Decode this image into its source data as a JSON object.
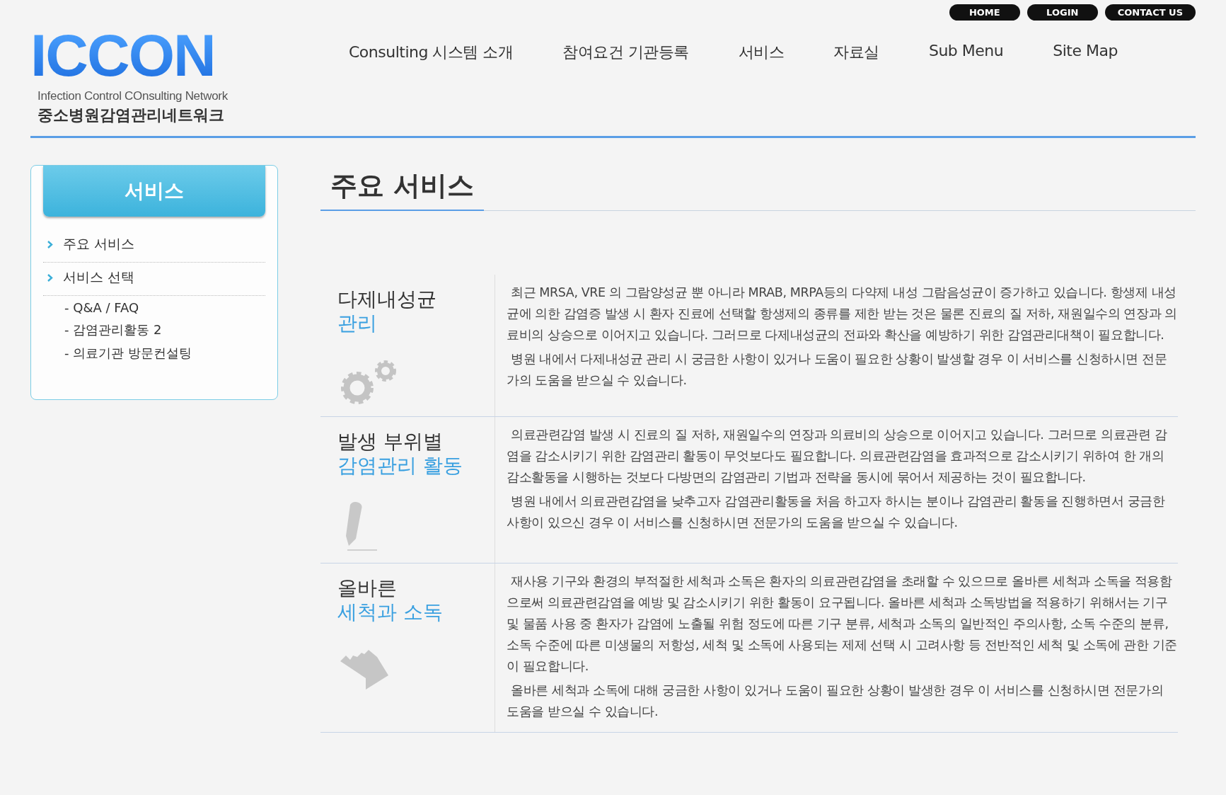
{
  "logo": {
    "title": "ICCON",
    "subtitle": "Infection Control COnsulting Network",
    "korean_name": "중소병원감염관리네트워크"
  },
  "top_links": [
    "HOME",
    "LOGIN",
    "CONTACT US"
  ],
  "nav": [
    "Consulting 시스템 소개",
    "참여요건 기관등록",
    "서비스",
    "자료실",
    "Sub Menu",
    "Site Map"
  ],
  "sidebar": {
    "title": "서비스",
    "items": [
      {
        "kind": "main",
        "label": "주요 서비스"
      },
      {
        "kind": "main",
        "label": "서비스 선택"
      },
      {
        "kind": "sub",
        "label": "- Q&A / FAQ"
      },
      {
        "kind": "sub",
        "label": "- 감염관리활동 2"
      },
      {
        "kind": "sub",
        "label": "- 의료기관 방문컨설팅"
      }
    ]
  },
  "page_title": "주요 서비스",
  "sections": [
    {
      "title": "다제내성균",
      "title_accent": "관리",
      "kind": "gears",
      "paragraphs": [
        "최근 MRSA, VRE 의 그람양성균 뿐 아니라 MRAB, MRPA등의 다약제 내성 그람음성균이 증가하고 있습니다. 항생제 내성균에 의한 감염증 발생 시 환자 진료에 선택할 항생제의 종류를 제한 받는 것은 물론 진료의 질 저하, 재원일수의 연장과 의료비의 상승으로 이어지고 있습니다. 그러므로 다제내성균의 전파와 확산을 예방하기 위한 감염관리대책이 필요합니다.",
        "병원 내에서 다제내성균 관리 시 궁금한 사항이 있거나 도움이 필요한 상황이 발생할 경우 이 서비스를 신청하시면 전문가의 도움을 받으실 수 있습니다."
      ]
    },
    {
      "title": "발생 부위별",
      "title_accent": "감염관리 활동",
      "kind": "pencil",
      "paragraphs": [
        "의료관련감염 발생 시 진료의 질 저하, 재원일수의 연장과 의료비의 상승으로 이어지고 있습니다. 그러므로 의료관련 감염을 감소시키기 위한 감염관리 활동이 무엇보다도 필요합니다. 의료관련감염을 효과적으로 감소시키기 위하여 한 개의 감소활동을 시행하는 것보다 다방면의 감염관리 기법과 전략을 동시에 묶어서 제공하는 것이 필요합니다.",
        "병원 내에서 의료관련감염을 낮추고자 감염관리활동을 처음 하고자 하시는 분이나 감염관리 활동을 진행하면서 궁금한 사항이 있으신 경우 이 서비스를 신청하시면 전문가의 도움을 받으실 수 있습니다."
      ]
    },
    {
      "title": "올바른",
      "title_accent": "세척과 소독",
      "kind": "hand",
      "paragraphs": [
        "재사용 기구와 환경의 부적절한 세척과 소독은 환자의 의료관련감염을 초래할 수 있으므로 올바른 세척과 소독을 적용함으로써 의료관련감염을 예방 및 감소시키기 위한 활동이 요구됩니다. 올바른 세척과 소독방법을 적용하기 위해서는 기구 및 물품 사용 중 환자가 감염에 노출될 위험 정도에 따른 기구 분류, 세척과 소독의 일반적인 주의사항, 소독 수준의 분류, 소독 수준에 따른 미생물의 저항성, 세척 및 소독에 사용되는 제제 선택 시 고려사항 등 전반적인 세척 및 소독에 관한 기준이 필요합니다.",
        "올바른 세척과 소독에 대해 궁금한 사항이 있거나 도움이 필요한 상황이 발생한 경우 이 서비스를 신청하시면 전문가의 도움을 받으실 수 있습니다."
      ]
    }
  ]
}
